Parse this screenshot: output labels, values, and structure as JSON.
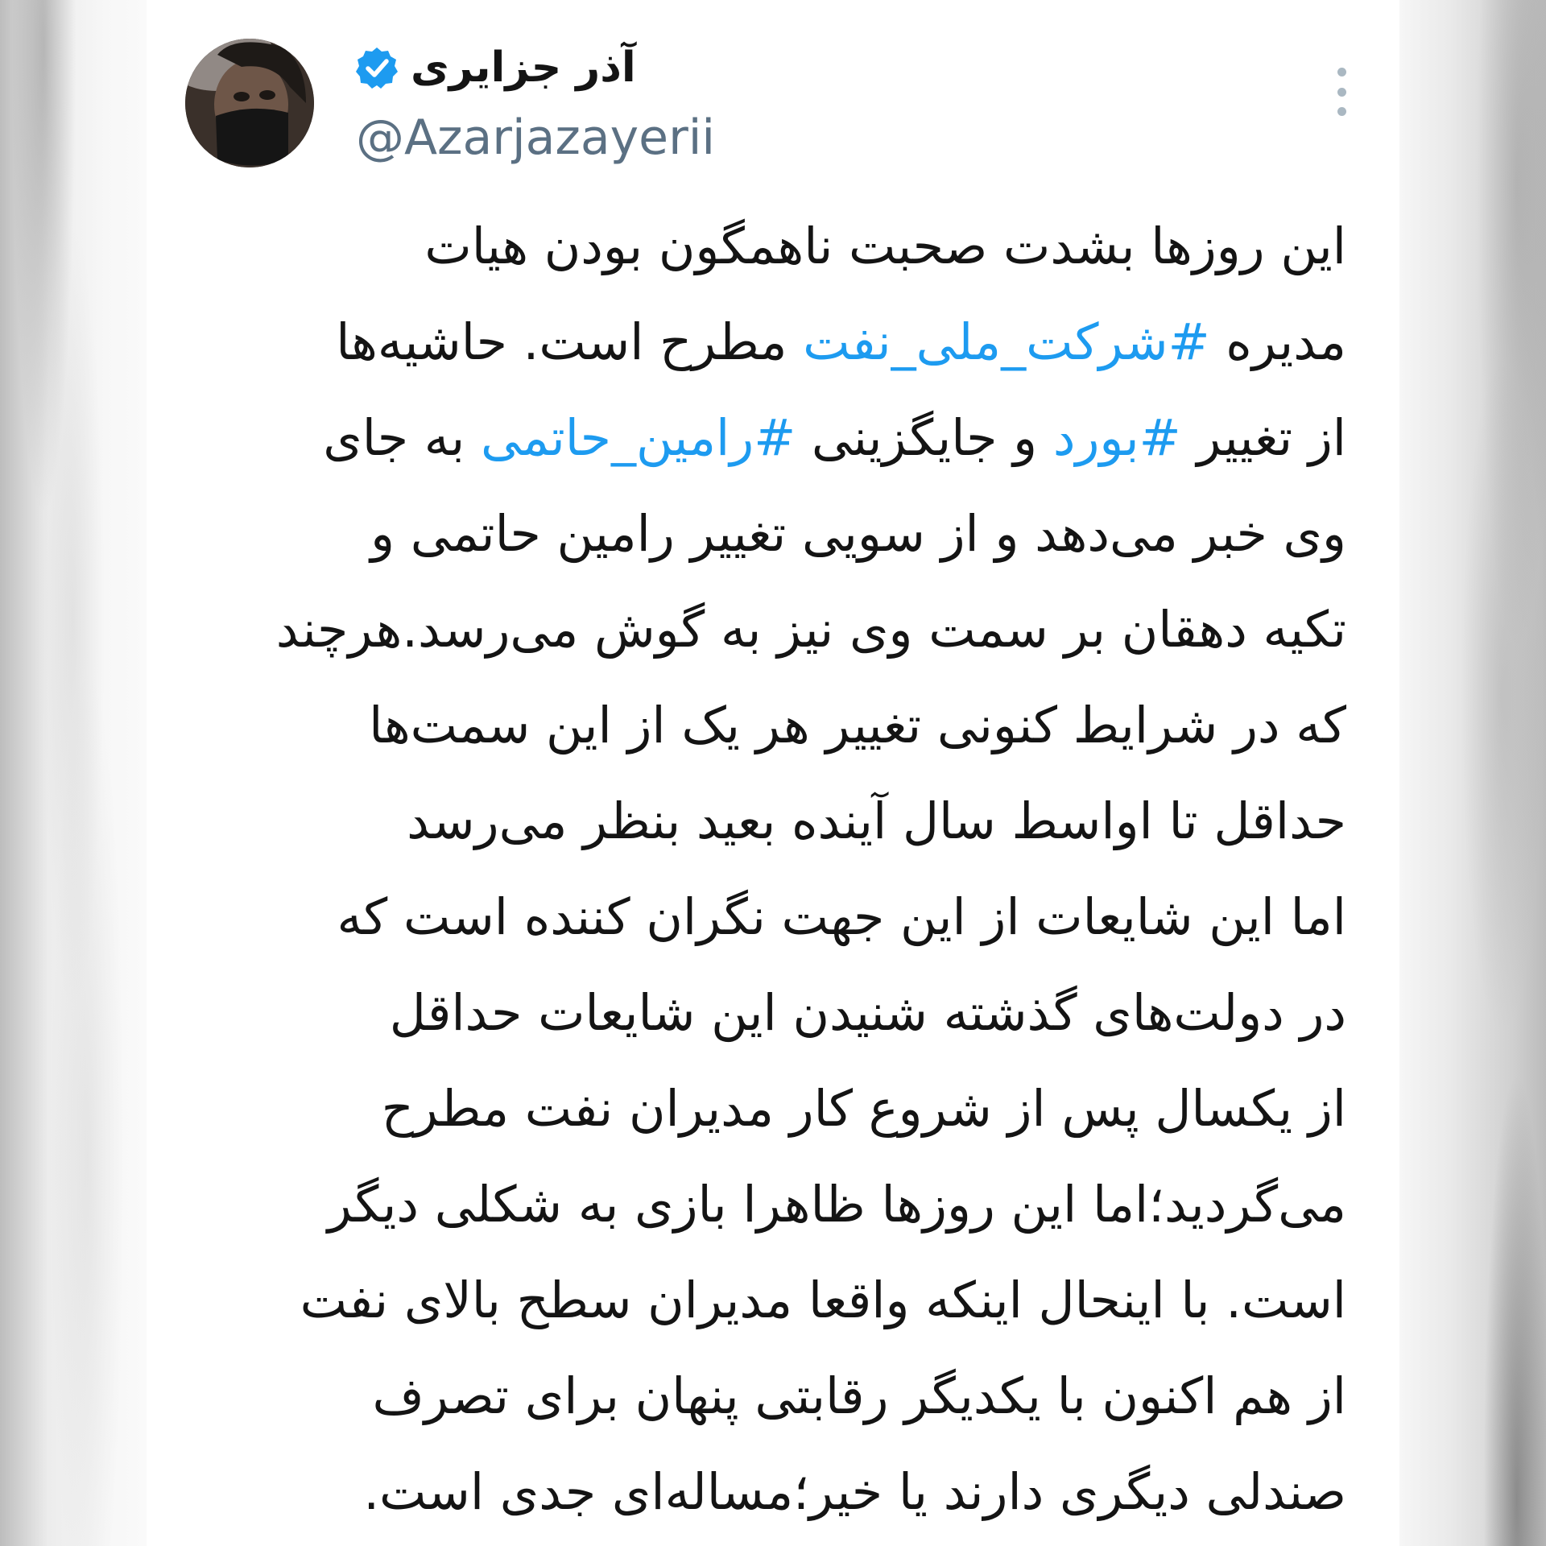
{
  "tweet": {
    "display_name": "آذر جزایری",
    "handle": "@Azarjazayerii",
    "verified": true,
    "lines": [
      [
        {
          "t": "این روزها بشدت صحبت ناهمگون بودن هیات"
        }
      ],
      [
        {
          "t": "مدیره "
        },
        {
          "t": "#شرکت_ملی_نفت",
          "tag": true
        },
        {
          "t": " مطرح است. حاشیه‌ها"
        }
      ],
      [
        {
          "t": "از تغییر "
        },
        {
          "t": "#بورد",
          "tag": true
        },
        {
          "t": " و جایگزینی "
        },
        {
          "t": "#رامین_حاتمی",
          "tag": true
        },
        {
          "t": " به جای"
        }
      ],
      [
        {
          "t": "وی خبر می‌دهد و از سویی تغییر رامین حاتمی و"
        }
      ],
      [
        {
          "t": "تکیه دهقان بر سمت وی نیز به گوش می‌رسد.هرچند"
        }
      ],
      [
        {
          "t": "که در شرایط کنونی تغییر هر یک از این سمت‌ها"
        }
      ],
      [
        {
          "t": "حداقل تا اواسط سال آینده بعید بنظر می‌رسد"
        }
      ],
      [
        {
          "t": "اما این شایعات از این جهت نگران کننده است که"
        }
      ],
      [
        {
          "t": "در دولت‌های گذشته شنیدن این شایعات حداقل"
        }
      ],
      [
        {
          "t": "از یکسال پس از شروع کار مدیران نفت مطرح"
        }
      ],
      [
        {
          "t": "می‌گردید؛اما این روزها ظاهرا بازی به شکلی دیگر"
        }
      ],
      [
        {
          "t": "است. با اینحال اینکه واقعا مدیران سطح بالای نفت"
        }
      ],
      [
        {
          "t": "از هم اکنون با یکدیگر رقابتی پنهان برای تصرف"
        }
      ],
      [
        {
          "t": "صندلی دیگری دارند یا خیر؛مساله‌ای جدی است."
        }
      ]
    ]
  },
  "colors": {
    "text": "#141414",
    "handle": "#5b7083",
    "hashtag": "#1d9bf0",
    "verified_badge": "#1d9bf0",
    "more_dots": "#aab8c2"
  },
  "icons": {
    "verified": "verified-badge-icon",
    "more": "more-options-icon"
  }
}
